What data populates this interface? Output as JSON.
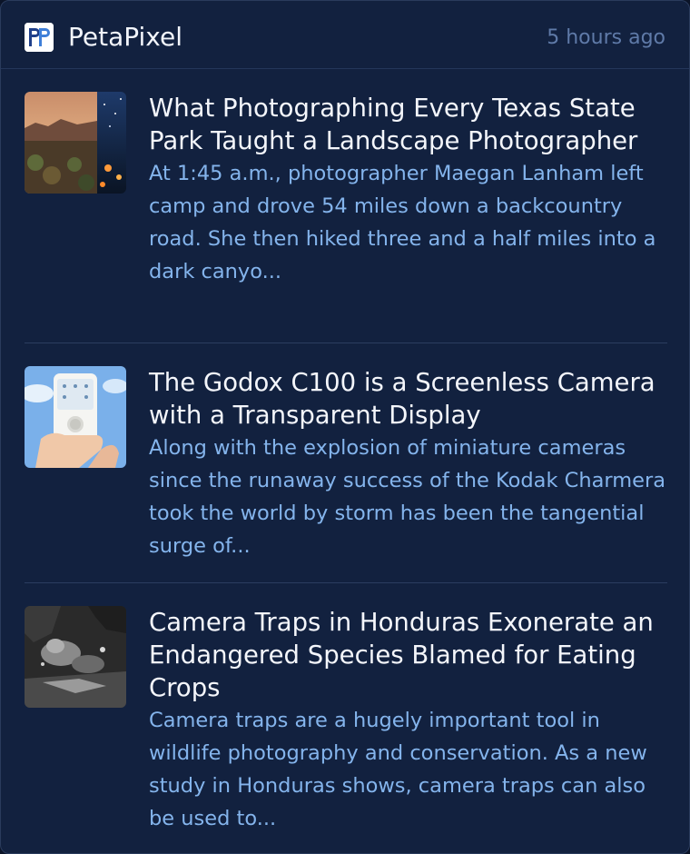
{
  "header": {
    "site_name": "PetaPixel",
    "logo_text": "PP",
    "timestamp": "5 hours ago"
  },
  "articles": [
    {
      "title": "What Photographing Every Texas State Park Taught a Landscape Photographer",
      "excerpt": "At 1:45 a.m., photographer Maegan Lanham left camp and drove 54 miles down a backcountry road. She then hiked three and a half miles into a dark canyo...",
      "thumbnail": "desert-landscape-and-night-sky"
    },
    {
      "title": "The Godox C100 is a Screenless Camera with a Transparent Display",
      "excerpt": "Along with the explosion of miniature cameras since the runaway success of the Kodak Charmera took the world by storm has been the tangential surge of...",
      "thumbnail": "hand-holding-white-camera"
    },
    {
      "title": "Camera Traps in Honduras Exonerate an Endangered Species Blamed for Eating Crops",
      "excerpt": "Camera traps are a hugely important tool in wildlife photography and conservation. As a new study in Honduras shows, camera traps can also be used to...",
      "thumbnail": "night-camera-trap-photo"
    }
  ],
  "colors": {
    "background": "#12213f",
    "title": "#f4f6fb",
    "excerpt": "#84b4ec",
    "timestamp": "#5f7aa8",
    "divider": "#2b3d60"
  }
}
